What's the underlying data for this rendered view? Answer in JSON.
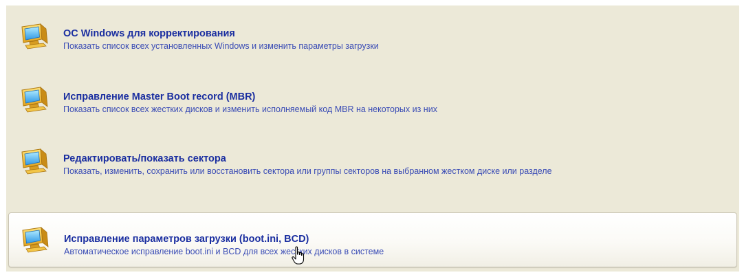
{
  "options": [
    {
      "title": "ОС Windows для корректирования",
      "description": "Показать список всех установленных Windows и изменить параметры загрузки",
      "icon": "monitor-icon"
    },
    {
      "title": "Исправление Master Boot record (MBR)",
      "description": "Показать список всех жестких дисков и изменить исполняемый код MBR на некоторых из них",
      "icon": "monitor-icon"
    },
    {
      "title": "Редактировать/показать сектора",
      "description": "Показать, изменить, сохранить или восстановить сектора или группы секторов на выбранном жестком диске или разделе",
      "icon": "monitor-icon"
    },
    {
      "title": "Исправление параметров загрузки (boot.ini, BCD)",
      "description": "Автоматическое исправление boot.ini и BCD для всех жестких дисков в системе",
      "icon": "monitor-icon"
    }
  ],
  "selected_option_index": 3,
  "colors": {
    "panel_background": "#ece9d8",
    "title_text": "#1a2ea0",
    "description_text": "#3a4cb5"
  }
}
